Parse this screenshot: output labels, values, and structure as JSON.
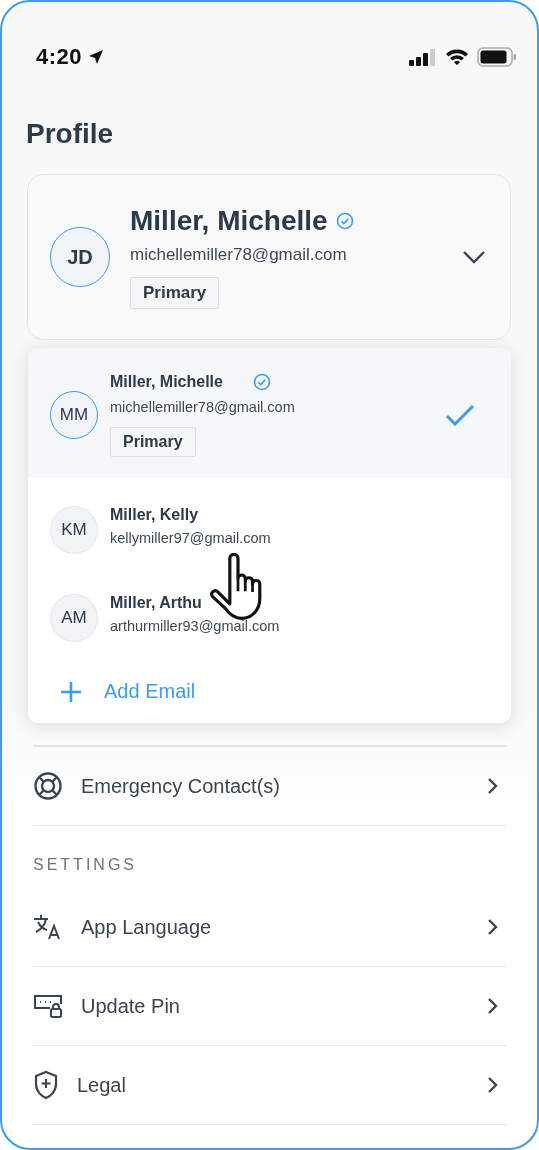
{
  "status_bar": {
    "time": "4:20"
  },
  "title": "Profile",
  "account": {
    "initials": "JD",
    "name": "Miller, Michelle",
    "verified": true,
    "email": "michellemiller78@gmail.com",
    "badge": "Primary",
    "expanded": true
  },
  "accounts": [
    {
      "initials": "MM",
      "name": "Miller, Michelle",
      "verified": true,
      "email": "michellemiller78@gmail.com",
      "badge": "Primary",
      "selected": true
    },
    {
      "initials": "KM",
      "name": "Miller, Kelly",
      "verified": false,
      "email": "kellymiller97@gmail.com",
      "selected": false
    },
    {
      "initials": "AM",
      "name": "Miller, Arthu",
      "verified": false,
      "email": "arthurmiller93@gmail.com",
      "selected": false
    }
  ],
  "add_email": {
    "label": "Add Email"
  },
  "menu_items": [
    {
      "label": "Emergency Contact(s)"
    }
  ],
  "settings": {
    "heading": "SETTINGS",
    "items": [
      {
        "label": "App Language"
      },
      {
        "label": "Update Pin"
      },
      {
        "label": "Legal"
      }
    ]
  }
}
